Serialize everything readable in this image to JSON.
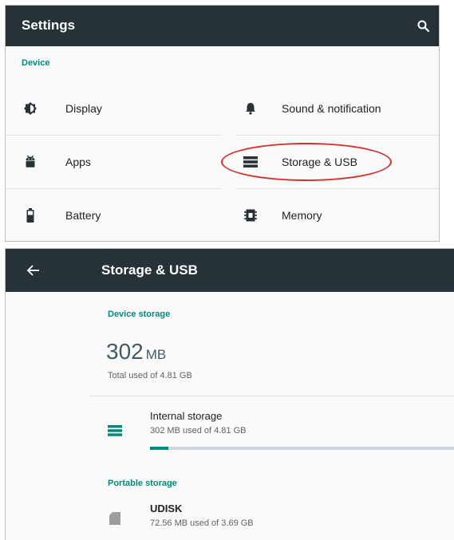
{
  "settings": {
    "title": "Settings",
    "section": "Device",
    "tiles": [
      {
        "label": "Display",
        "icon": "brightness-icon"
      },
      {
        "label": "Sound & notification",
        "icon": "bell-icon"
      },
      {
        "label": "Apps",
        "icon": "android-icon"
      },
      {
        "label": "Storage & USB",
        "icon": "storage-icon"
      },
      {
        "label": "Battery",
        "icon": "battery-icon"
      },
      {
        "label": "Memory",
        "icon": "memory-chip-icon"
      }
    ],
    "highlighted_tile": "Storage & USB",
    "highlight_color": "#d32f2f"
  },
  "storage": {
    "title": "Storage & USB",
    "device_section": "Device storage",
    "used_value": "302",
    "used_unit": "MB",
    "total_used": "Total used of 4.81 GB",
    "internal": {
      "name": "Internal storage",
      "detail": "302 MB used of 4.81 GB",
      "used_fraction": 0.06
    },
    "portable_section": "Portable storage",
    "portable": {
      "name": "UDISK",
      "detail": "72.56 MB used of 3.69 GB"
    }
  },
  "colors": {
    "toolbar": "#263238",
    "accent": "#00897b",
    "background": "#fafafa"
  }
}
